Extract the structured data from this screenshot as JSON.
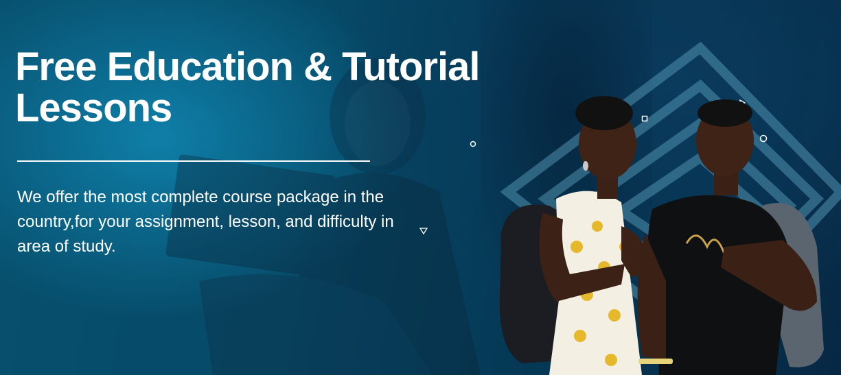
{
  "hero": {
    "headline": "Free Education & Tutorial Lessons",
    "description": "We offer the most complete course package in the country,for your assignment, lesson, and difficulty in area of study."
  },
  "colors": {
    "background_primary": "#064a68",
    "background_glow": "#0f7fa8",
    "text": "#ffffff",
    "accent_outline": "#5fa6c4"
  },
  "images": {
    "background_person": "student-with-laptop-silhouette",
    "foreground_people": "two-students-with-backpacks"
  },
  "decorations": [
    "circle-outline",
    "square-outline",
    "triangle-outline",
    "circle-outline",
    "triangle-outline"
  ]
}
